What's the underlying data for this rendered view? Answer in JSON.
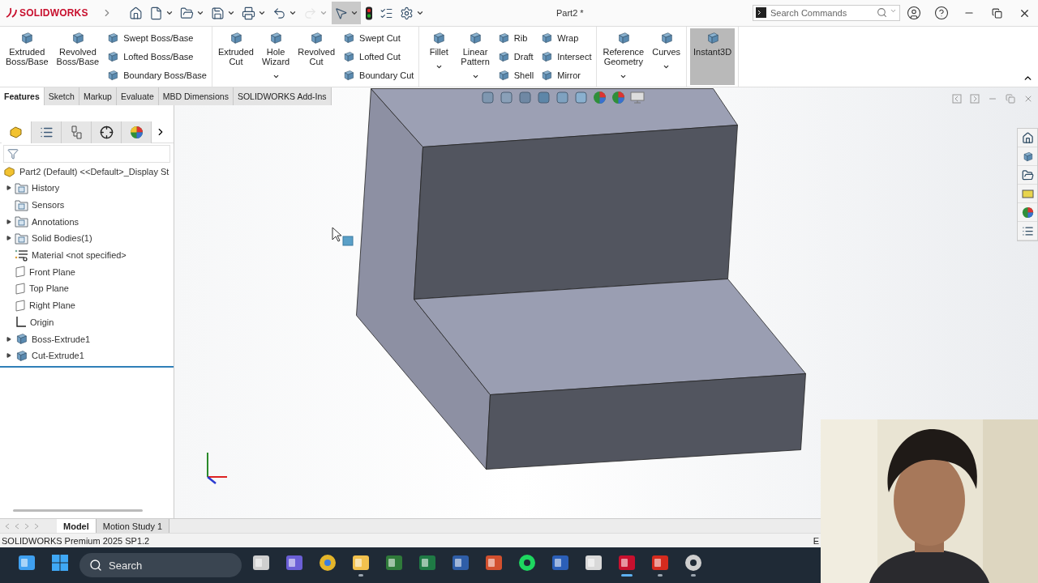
{
  "titlebar": {
    "logo": "SOLIDWORKS",
    "title": "Part2 *",
    "search": {
      "placeholder": "Search Commands"
    },
    "quick_access": [
      {
        "kind": "home",
        "disabled": false,
        "selected": false,
        "menu": false
      },
      {
        "kind": "new",
        "disabled": false,
        "selected": false,
        "menu": true
      },
      {
        "kind": "open",
        "disabled": false,
        "selected": false,
        "menu": true
      },
      {
        "kind": "save",
        "disabled": false,
        "selected": false,
        "menu": true
      },
      {
        "kind": "print",
        "disabled": false,
        "selected": false,
        "menu": true
      },
      {
        "kind": "undo",
        "disabled": false,
        "selected": false,
        "menu": true
      },
      {
        "kind": "redo",
        "disabled": true,
        "selected": false,
        "menu": true
      },
      {
        "kind": "select",
        "disabled": false,
        "selected": true,
        "menu": true
      },
      {
        "kind": "rebuild",
        "disabled": false,
        "selected": false,
        "menu": false
      },
      {
        "kind": "file-properties",
        "disabled": false,
        "selected": false,
        "menu": false
      },
      {
        "kind": "options",
        "disabled": false,
        "selected": false,
        "menu": true
      }
    ]
  },
  "ribbon": {
    "groups": [
      {
        "items": [
          {
            "kind": "large",
            "label": "Extruded\nBoss/Base",
            "menu": false,
            "selected": false
          },
          {
            "kind": "large",
            "label": "Revolved\nBoss/Base",
            "menu": false,
            "selected": false
          },
          {
            "kind": "stack",
            "labels": [
              "Swept Boss/Base",
              "Lofted Boss/Base",
              "Boundary Boss/Base"
            ]
          }
        ]
      },
      {
        "items": [
          {
            "kind": "large",
            "label": "Extruded\nCut",
            "menu": false,
            "selected": false
          },
          {
            "kind": "large",
            "label": "Hole\nWizard",
            "menu": true,
            "selected": false
          },
          {
            "kind": "large",
            "label": "Revolved\nCut",
            "menu": false,
            "selected": false
          },
          {
            "kind": "stack",
            "labels": [
              "Swept Cut",
              "Lofted Cut",
              "Boundary Cut"
            ]
          }
        ]
      },
      {
        "items": [
          {
            "kind": "large",
            "label": "Fillet",
            "menu": true,
            "selected": false
          },
          {
            "kind": "large",
            "label": "Linear\nPattern",
            "menu": true,
            "selected": false
          },
          {
            "kind": "stack",
            "labels": [
              "Rib",
              "Draft",
              "Shell"
            ]
          },
          {
            "kind": "stack",
            "labels": [
              "Wrap",
              "Intersect",
              "Mirror"
            ]
          }
        ]
      },
      {
        "items": [
          {
            "kind": "large",
            "label": "Reference\nGeometry",
            "menu": true,
            "selected": false
          },
          {
            "kind": "large",
            "label": "Curves",
            "menu": true,
            "selected": false
          }
        ]
      },
      {
        "items": [
          {
            "kind": "large",
            "label": "Instant3D",
            "menu": false,
            "selected": true
          }
        ]
      }
    ]
  },
  "command_tabs": [
    {
      "label": "Features",
      "selected": true
    },
    {
      "label": "Sketch",
      "selected": false
    },
    {
      "label": "Markup",
      "selected": false
    },
    {
      "label": "Evaluate",
      "selected": false
    },
    {
      "label": "MBD Dimensions",
      "selected": false
    },
    {
      "label": "SOLIDWORKS Add-Ins",
      "selected": false
    }
  ],
  "panel_tabs": [
    {
      "kind": "feature-manager",
      "selected": true
    },
    {
      "kind": "property-manager",
      "selected": false
    },
    {
      "kind": "configuration-manager",
      "selected": false
    },
    {
      "kind": "dimxpert",
      "selected": false
    },
    {
      "kind": "display-manager",
      "selected": false
    }
  ],
  "tree": {
    "root": "Part2 (Default) <<Default>_Display St",
    "items": [
      {
        "kind": "history",
        "label": "History",
        "expander": true
      },
      {
        "kind": "sensors",
        "label": "Sensors",
        "expander": false
      },
      {
        "kind": "annotations",
        "label": "Annotations",
        "expander": true
      },
      {
        "kind": "bodies",
        "label": "Solid Bodies(1)",
        "expander": true
      },
      {
        "kind": "material",
        "label": "Material <not specified>",
        "expander": false
      },
      {
        "kind": "plane",
        "label": "Front Plane",
        "expander": false
      },
      {
        "kind": "plane",
        "label": "Top Plane",
        "expander": false
      },
      {
        "kind": "plane",
        "label": "Right Plane",
        "expander": false
      },
      {
        "kind": "origin",
        "label": "Origin",
        "expander": false
      },
      {
        "kind": "boss",
        "label": "Boss-Extrude1",
        "expander": true
      },
      {
        "kind": "cut",
        "label": "Cut-Extrude1",
        "expander": true
      }
    ]
  },
  "bottom_tabs": [
    {
      "label": "Model",
      "selected": true
    },
    {
      "label": "Motion Study 1",
      "selected": false
    }
  ],
  "status_bar": {
    "text": "SOLIDWORKS Premium 2025 SP1.2",
    "right": "E"
  },
  "taskbar": {
    "search": {
      "placeholder": "Search"
    },
    "apps": [
      {
        "kind": "widgets",
        "running": false
      },
      {
        "kind": "start",
        "running": false
      },
      {
        "kind": "search"
      },
      {
        "kind": "taskview",
        "running": false
      },
      {
        "kind": "chat",
        "running": false
      },
      {
        "kind": "chrome",
        "running": false
      },
      {
        "kind": "explorer",
        "running": true
      },
      {
        "kind": "project",
        "running": false
      },
      {
        "kind": "excel",
        "running": false
      },
      {
        "kind": "visio",
        "running": false
      },
      {
        "kind": "powerpoint",
        "running": false
      },
      {
        "kind": "spotify",
        "running": false
      },
      {
        "kind": "word",
        "running": false
      },
      {
        "kind": "tool",
        "running": false
      },
      {
        "kind": "solidworks",
        "running": true
      },
      {
        "kind": "acrobat",
        "running": true
      },
      {
        "kind": "recorder",
        "running": true
      }
    ]
  }
}
